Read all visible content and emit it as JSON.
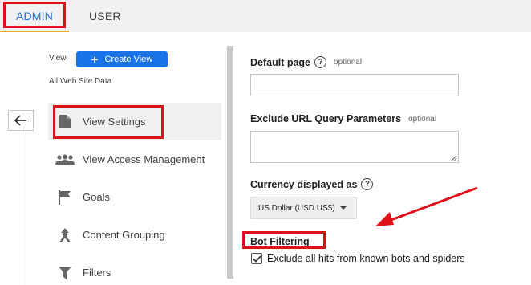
{
  "tabs": {
    "admin": "ADMIN",
    "user": "USER"
  },
  "left": {
    "view_label": "View",
    "create_view_label": "Create View",
    "site_data": "All Web Site Data"
  },
  "menu": [
    {
      "label": "View Settings",
      "icon": "document-icon"
    },
    {
      "label": "View Access Management",
      "icon": "people-icon"
    },
    {
      "label": "Goals",
      "icon": "flag-icon"
    },
    {
      "label": "Content Grouping",
      "icon": "grouping-icon"
    },
    {
      "label": "Filters",
      "icon": "filter-icon"
    }
  ],
  "form": {
    "default_page_label": "Default page",
    "default_page_optional": "optional",
    "default_page_value": "",
    "exclude_url_label": "Exclude URL Query Parameters",
    "exclude_url_optional": "optional",
    "exclude_url_value": "",
    "currency_label": "Currency displayed as",
    "currency_value": "US Dollar (USD US$)",
    "bot_filtering_title": "Bot Filtering",
    "bot_filtering_checkbox": "Exclude all hits from known bots and spiders",
    "bot_filtering_checked": true,
    "help_glyph": "?"
  },
  "colors": {
    "accent_blue": "#1a73e8",
    "highlight_red": "#e0101a",
    "tab_underline": "#e8a33d"
  }
}
